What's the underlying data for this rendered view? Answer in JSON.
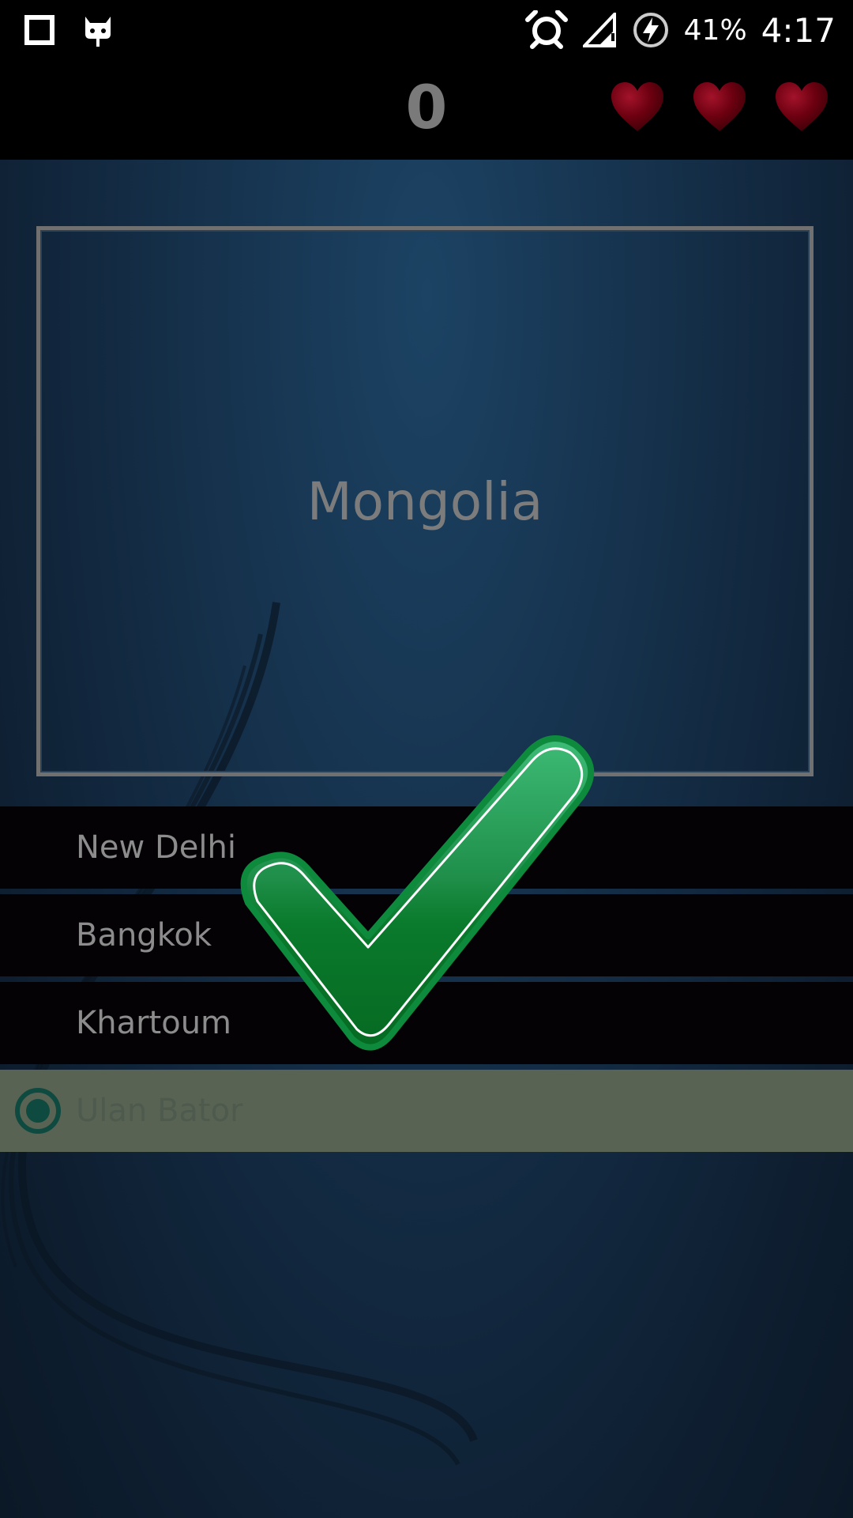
{
  "status_bar": {
    "battery_percent": "41%",
    "time": "4:17",
    "icons": [
      "square-notification-icon",
      "cyanogen-mascot-icon",
      "alarm-icon",
      "signal-icon",
      "charging-icon"
    ]
  },
  "game": {
    "score": "0",
    "lives": 3,
    "heart_color": "#6b0010"
  },
  "question": {
    "country": "Mongolia"
  },
  "answers": [
    {
      "label": "New Delhi",
      "selected": false
    },
    {
      "label": "Bangkok",
      "selected": false
    },
    {
      "label": "Khartoum",
      "selected": false
    },
    {
      "label": "Ulan Bator",
      "selected": true
    }
  ],
  "feedback": {
    "icon": "checkmark-icon",
    "correct": true,
    "color": "#0b7a2e"
  }
}
